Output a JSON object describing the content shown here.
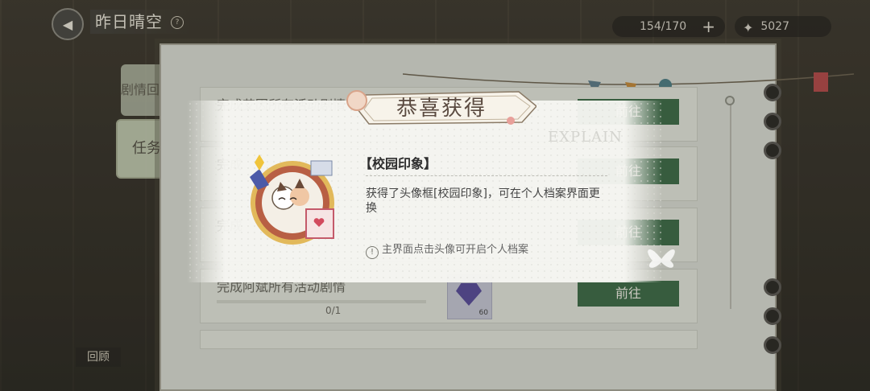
{
  "header": {
    "title": "昨日晴空",
    "title_badge": "?",
    "stamina": "154/170",
    "stamina_plus": "+",
    "currency": "5027"
  },
  "side_tabs": {
    "review": "剧情回顾",
    "task": "任务"
  },
  "bottom_tab": "回顾",
  "tasks": [
    {
      "name": "完成艾因所有活动剧情",
      "progress": "",
      "button": "前往",
      "reward_qty": ""
    },
    {
      "name": "完成",
      "progress": "",
      "button": "前往",
      "reward_qty": ""
    },
    {
      "name": "完成",
      "progress": "",
      "button": "前往",
      "reward_qty": ""
    },
    {
      "name": "完成阿斌所有活动剧情",
      "progress": "0/1",
      "button": "前往",
      "reward_qty": "60"
    }
  ],
  "popup": {
    "title": "恭喜获得",
    "item_name": "【校园印象】",
    "description": "获得了头像框[校园印象]，可在个人档案界面更换",
    "hint": "主界面点击头像可开启个人档案",
    "hint_icon": "!",
    "watermark": "EXPLAIN"
  },
  "colors": {
    "go_button": "#3f6c48",
    "panel": "#d8dbd2",
    "ribbon_text": "#5a4a40"
  },
  "icons": {
    "back": "back-arrow-icon",
    "stamina": "stamina-icon",
    "currency": "gem-icon",
    "hint": "exclamation-circle-icon"
  }
}
